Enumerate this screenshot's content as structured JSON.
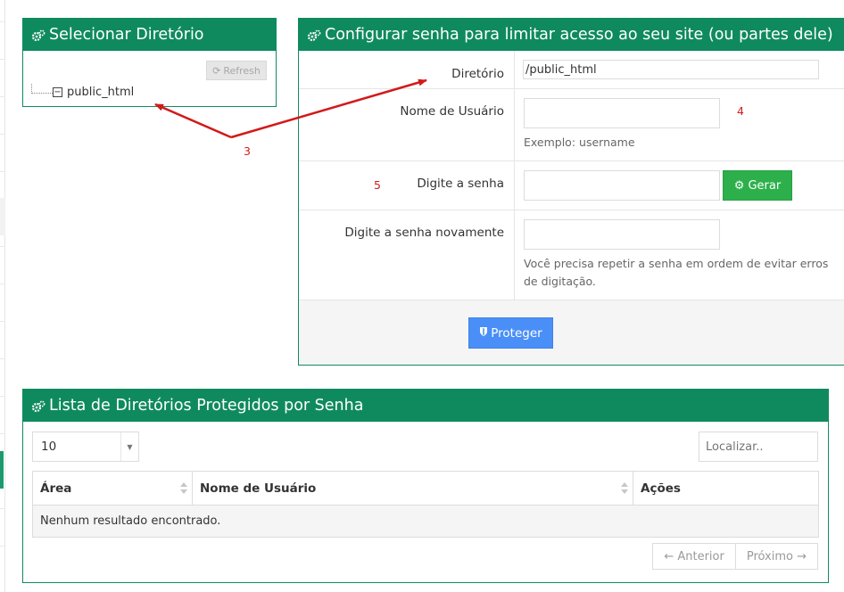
{
  "colors": {
    "panel_header": "#0f8a5f",
    "primary_button": "#4a8ff7",
    "success_button": "#2db04b",
    "annotation": "#d21a1a"
  },
  "select_directory": {
    "title": "Selecionar Diretório",
    "refresh_label": "Refresh",
    "tree_items": [
      {
        "label": "public_html",
        "expanded": true
      }
    ]
  },
  "configure_password": {
    "title": "Configurar senha para limitar acesso ao seu site (ou partes dele)",
    "fields": {
      "directory": {
        "label": "Diretório",
        "value": "/public_html"
      },
      "username": {
        "label": "Nome de Usuário",
        "value": "",
        "help": "Exemplo: username"
      },
      "password": {
        "label": "Digite a senha",
        "value": "",
        "generate_label": "Gerar"
      },
      "password_confirm": {
        "label": "Digite a senha novamente",
        "value": "",
        "help": "Você precisa repetir a senha em ordem de evitar erros de digitação."
      }
    },
    "protect_label": "Proteger"
  },
  "protected_list": {
    "title": "Lista de Diretórios Protegidos por Senha",
    "page_size": "10",
    "search_placeholder": "Localizar..",
    "columns": [
      "Área",
      "Nome de Usuário",
      "Ações"
    ],
    "empty_message": "Nenhum resultado encontrado.",
    "prev_label": "← Anterior",
    "next_label": "Próximo →"
  },
  "annotations": [
    "3",
    "4",
    "5"
  ]
}
